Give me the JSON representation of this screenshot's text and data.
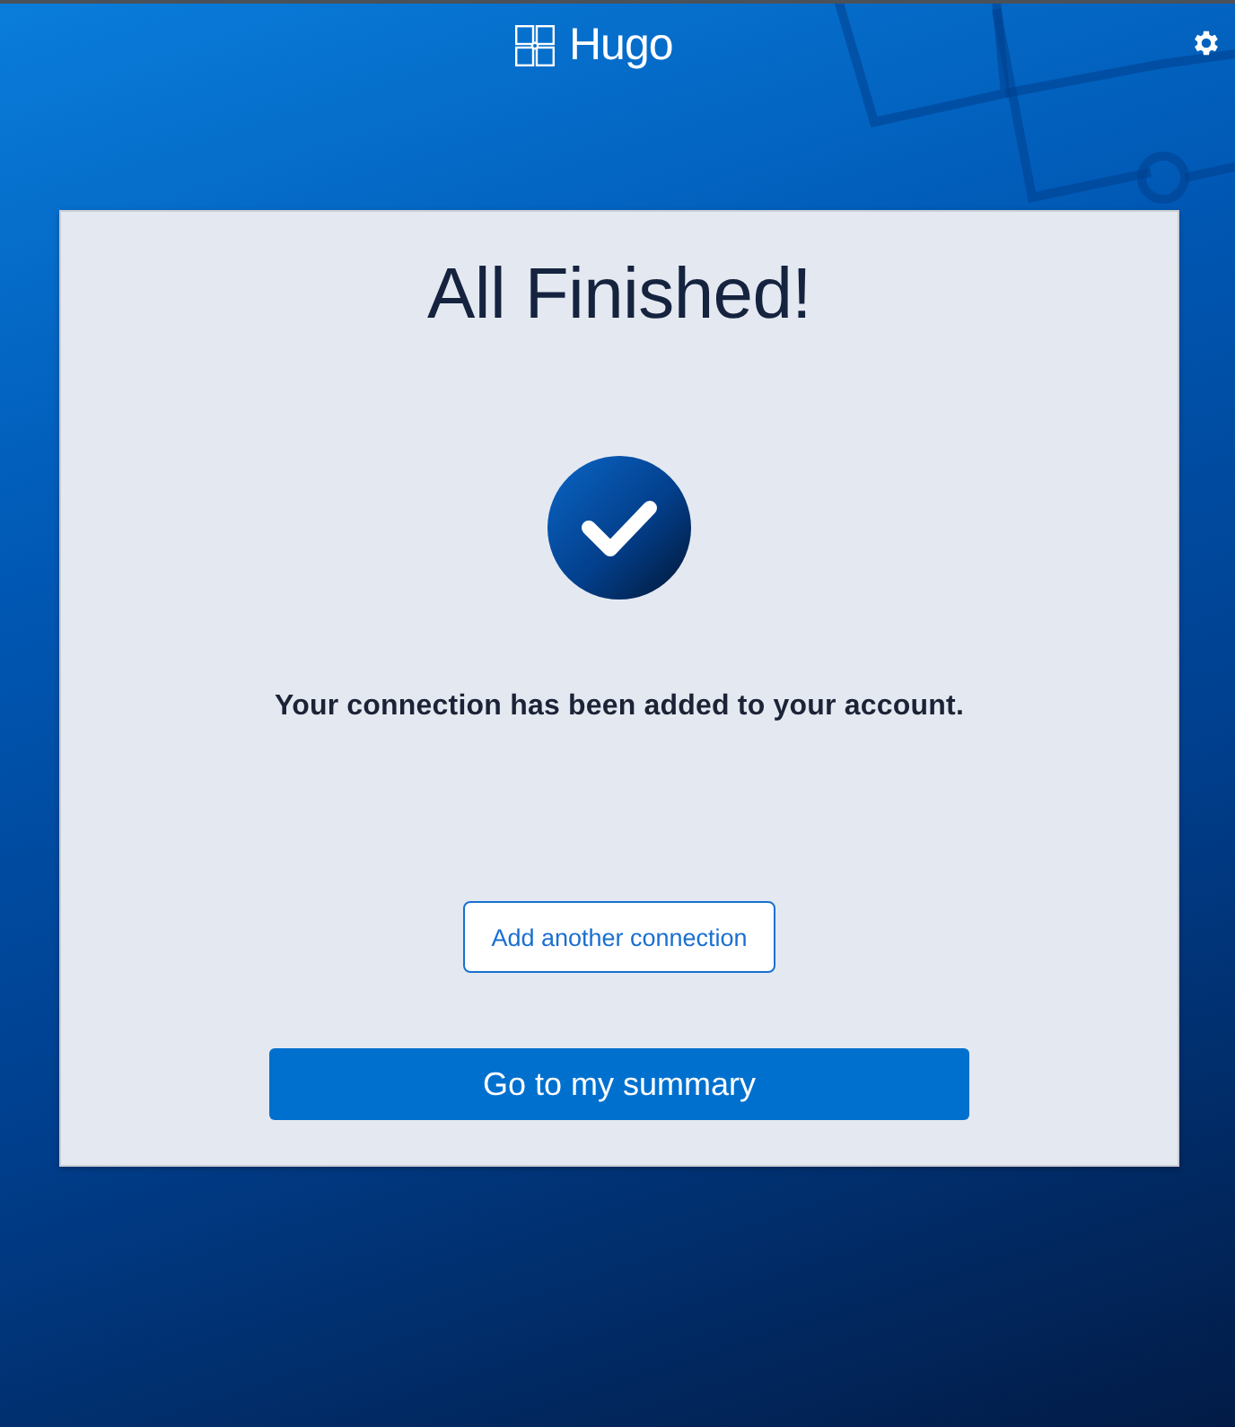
{
  "header": {
    "logo_text": "Hugo"
  },
  "card": {
    "title": "All Finished!",
    "message": "Your connection has been added to your account.",
    "secondary_button": "Add another connection",
    "primary_button": "Go to my summary"
  }
}
